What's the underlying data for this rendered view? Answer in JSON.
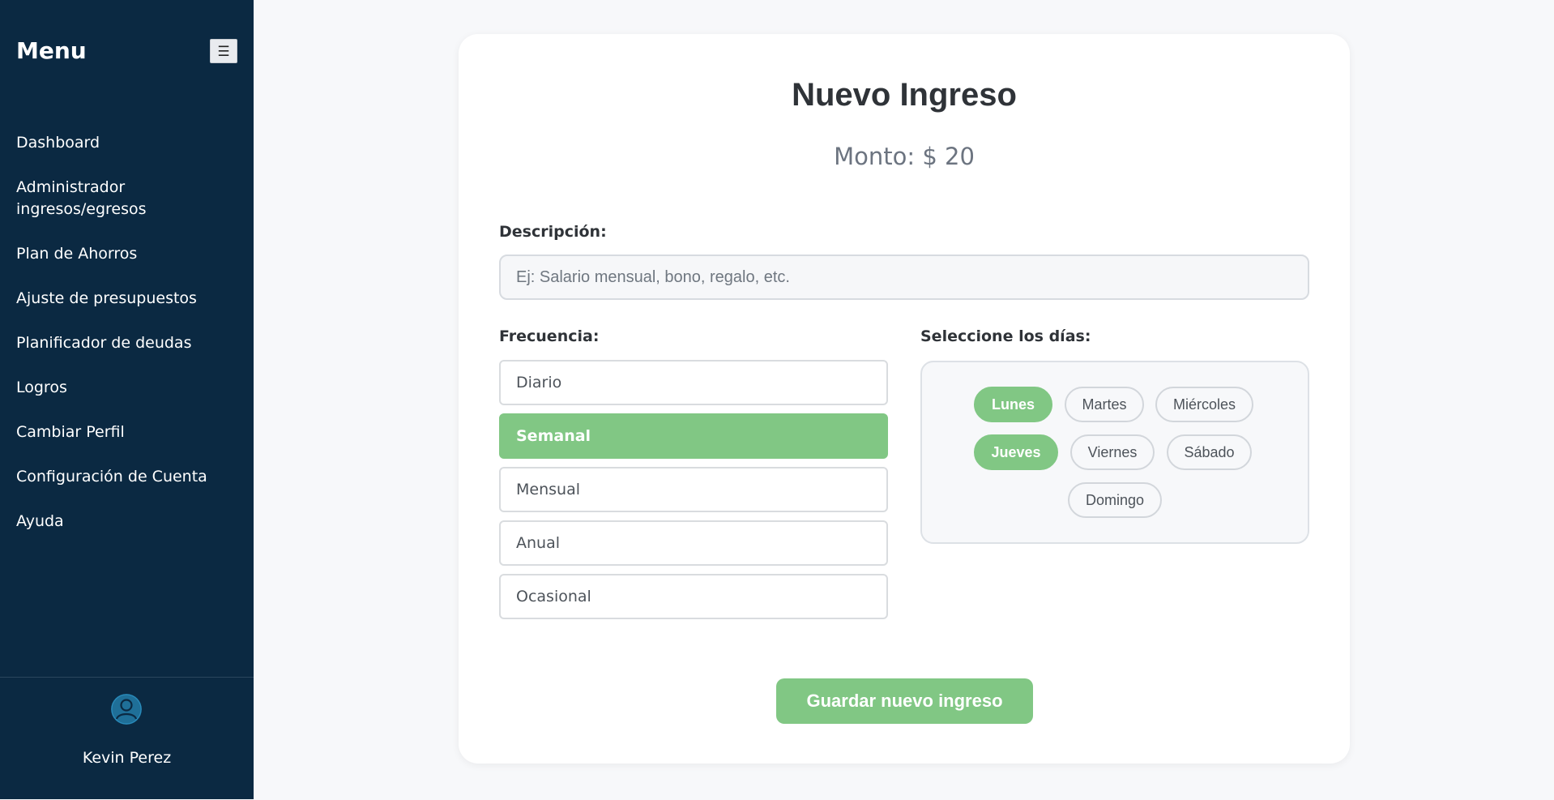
{
  "sidebar": {
    "title": "Menu",
    "toggle_icon": "☰",
    "items": [
      {
        "label": "Dashboard"
      },
      {
        "label": "Administrador ingresos/egresos"
      },
      {
        "label": "Plan de Ahorros"
      },
      {
        "label": "Ajuste de presupuestos"
      },
      {
        "label": "Planificador de deudas"
      },
      {
        "label": "Logros"
      },
      {
        "label": "Cambiar Perfil"
      },
      {
        "label": "Configuración de Cuenta"
      },
      {
        "label": "Ayuda"
      }
    ],
    "user": {
      "name": "Kevin Perez",
      "avatar_icon": "user-avatar-icon"
    }
  },
  "form": {
    "title": "Nuevo Ingreso",
    "amount": "Monto: $ 20",
    "description_label": "Descripción:",
    "description_placeholder": "Ej: Salario mensual, bono, regalo, etc.",
    "description_value": "",
    "frequency_label": "Frecuencia:",
    "frequencies": [
      {
        "label": "Diario",
        "selected": false
      },
      {
        "label": "Semanal",
        "selected": true
      },
      {
        "label": "Mensual",
        "selected": false
      },
      {
        "label": "Anual",
        "selected": false
      },
      {
        "label": "Ocasional",
        "selected": false
      }
    ],
    "days_label": "Seleccione los días:",
    "days": [
      {
        "label": "Lunes",
        "selected": true
      },
      {
        "label": "Martes",
        "selected": false
      },
      {
        "label": "Miércoles",
        "selected": false
      },
      {
        "label": "Jueves",
        "selected": true
      },
      {
        "label": "Viernes",
        "selected": false
      },
      {
        "label": "Sábado",
        "selected": false
      },
      {
        "label": "Domingo",
        "selected": false
      }
    ],
    "save_label": "Guardar nuevo ingreso"
  },
  "colors": {
    "sidebar_bg": "#0b2942",
    "accent": "#81c784",
    "page_bg": "#f7f8fa"
  }
}
